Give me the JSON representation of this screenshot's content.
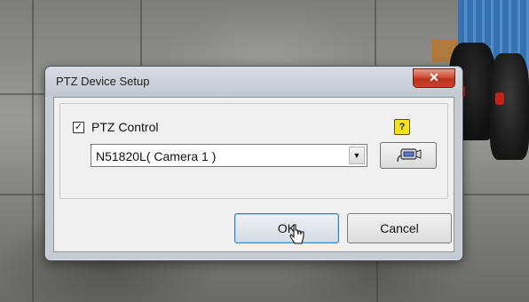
{
  "window": {
    "title": "PTZ Device Setup",
    "close_label": "✕"
  },
  "ptz_control": {
    "checkbox_mark": "✓",
    "checked": true,
    "label": "PTZ Control"
  },
  "help": {
    "icon": "help-icon",
    "label": "?"
  },
  "device_select": {
    "value": "N51820L( Camera 1 )",
    "arrow": "▼"
  },
  "ptz_button": {
    "icon": "ptz-camera-icon"
  },
  "buttons": {
    "ok_label": "OK",
    "cancel_label": "Cancel"
  },
  "colors": {
    "close_button": "#c8452b",
    "help_icon": "#f4e21c",
    "default_button_border": "#3c7fb1"
  }
}
